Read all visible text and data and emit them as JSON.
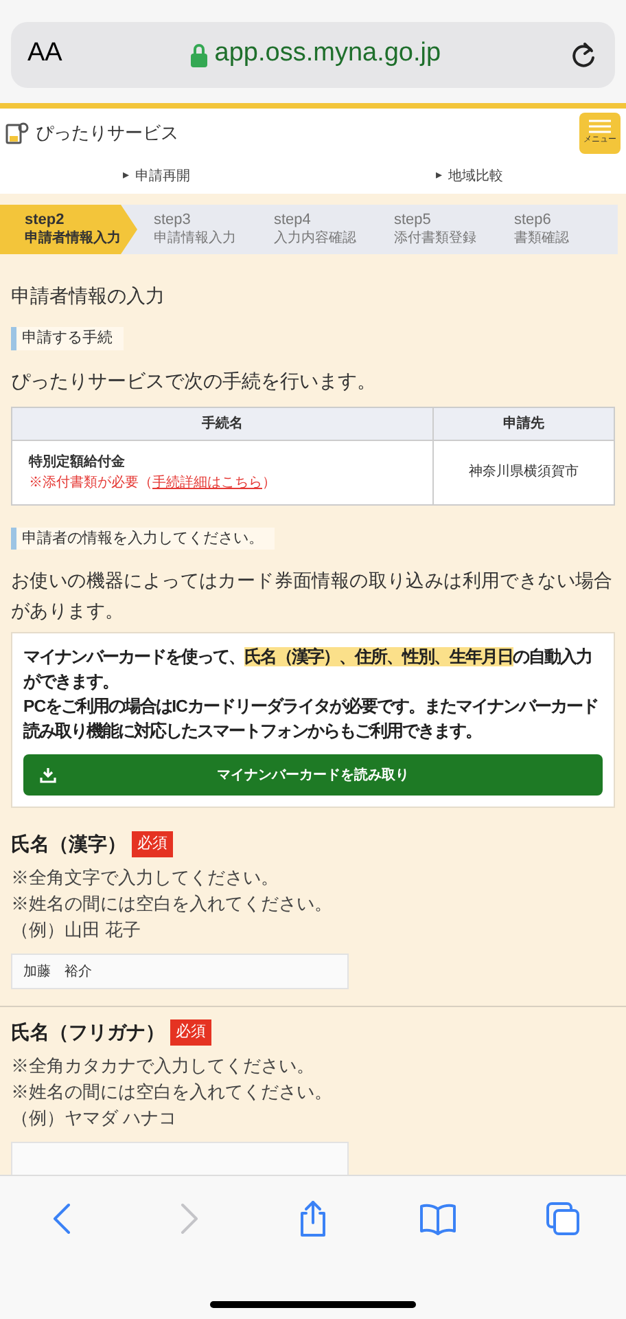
{
  "browser": {
    "text_size_button": "AA",
    "address": "app.oss.myna.go.jp"
  },
  "header": {
    "logo_text": "ぴったりサービス",
    "menu_label": "メニュー"
  },
  "sub_links": [
    {
      "marker": "▸",
      "label": "申請再開"
    },
    {
      "marker": "▸",
      "label": "地域比較"
    }
  ],
  "steps": [
    {
      "step": "step2",
      "label": "申請者情報入力",
      "selected": true
    },
    {
      "step": "step3",
      "label": "申請情報入力",
      "selected": false
    },
    {
      "step": "step4",
      "label": "入力内容確認",
      "selected": false
    },
    {
      "step": "step5",
      "label": "添付書類登録",
      "selected": false
    },
    {
      "step": "step6",
      "label": "書類確認",
      "selected": false
    }
  ],
  "page_title": "申請者情報の入力",
  "procedure_heading": "申請する手続",
  "procedure_text": "ぴったりサービスで次の手続を行います。",
  "table": {
    "columns": [
      "手続名",
      "申請先"
    ],
    "rows": [
      {
        "name": "特別定額給付金",
        "note": "※添付書類が必要（",
        "link": "手続詳細はこちら",
        "note_end": "）",
        "destination": "神奈川県横須賀市"
      }
    ]
  },
  "applicant_heading": "申請者の情報を入力してください。",
  "applicant_text": "お使いの機器によってはカード券面情報の取り込みは利用できない場合があります。",
  "card_info": {
    "lines": [
      [
        {
          "text": "マイナンバーカードを使って、",
          "highlighted": false
        },
        {
          "text": "氏名（漢字）、住所、性別、生年月日",
          "highlighted": true
        },
        {
          "text": "の自動入力ができます。",
          "highlighted": false
        }
      ],
      [
        {
          "text": "PCをご利用の場合はICカードリーダライタが必要です。またマイナンバーカード読み取り機能に対応したスマートフォンからもご利用できます。",
          "highlighted": false
        }
      ]
    ],
    "button": "マイナンバーカードを読み取り"
  },
  "fields": [
    {
      "label": "氏名（漢字）",
      "badge": "必須",
      "hints": [
        "※全角文字で入力してください。",
        "※姓名の間には空白を入れてください。",
        "（例）山田 花子"
      ],
      "value": "加藤　裕介"
    },
    {
      "label": "氏名（フリガナ）",
      "badge": "必須",
      "hints": [
        "※全角カタカナで入力してください。",
        "※姓名の間には空白を入れてください。",
        "（例）ヤマダ ハナコ"
      ]
    }
  ],
  "toolbar": [
    {
      "kind": "back",
      "disabled": false
    },
    {
      "kind": "forward",
      "disabled": true
    },
    {
      "kind": "share",
      "disabled": false
    },
    {
      "kind": "bookmarks",
      "disabled": false
    },
    {
      "kind": "tabs",
      "disabled": false
    }
  ]
}
